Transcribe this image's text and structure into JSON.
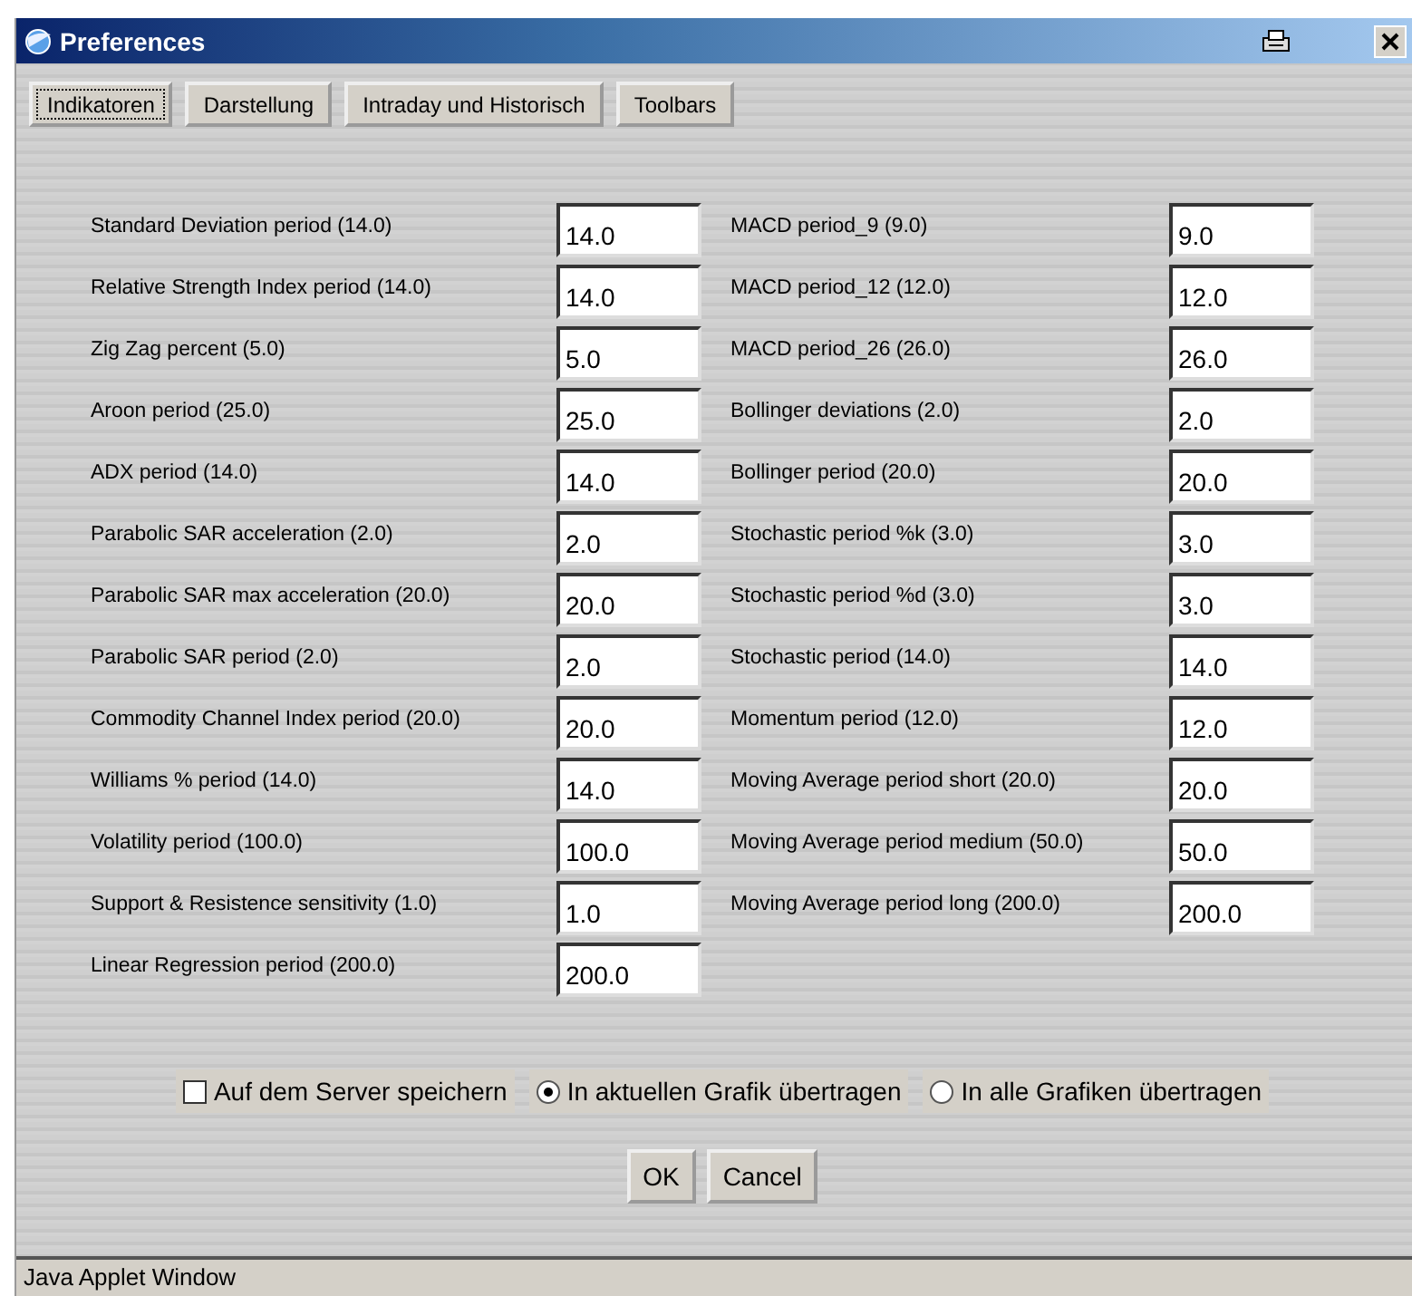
{
  "window": {
    "title": "Preferences"
  },
  "tabs": [
    {
      "label": "Indikatoren",
      "selected": true
    },
    {
      "label": "Darstellung",
      "selected": false
    },
    {
      "label": "Intraday und Historisch",
      "selected": false
    },
    {
      "label": "Toolbars",
      "selected": false
    }
  ],
  "left_fields": [
    {
      "label": "Standard Deviation period (14.0)",
      "value": "14.0"
    },
    {
      "label": "Relative Strength Index period (14.0)",
      "value": "14.0"
    },
    {
      "label": "Zig Zag percent (5.0)",
      "value": "5.0"
    },
    {
      "label": "Aroon period (25.0)",
      "value": "25.0"
    },
    {
      "label": "ADX period (14.0)",
      "value": "14.0"
    },
    {
      "label": "Parabolic SAR acceleration (2.0)",
      "value": "2.0"
    },
    {
      "label": "Parabolic SAR max acceleration (20.0)",
      "value": "20.0"
    },
    {
      "label": "Parabolic SAR period (2.0)",
      "value": "2.0"
    },
    {
      "label": "Commodity Channel Index period (20.0)",
      "value": "20.0"
    },
    {
      "label": "Williams % period (14.0)",
      "value": "14.0"
    },
    {
      "label": "Volatility period (100.0)",
      "value": "100.0"
    },
    {
      "label": "Support & Resistence sensitivity (1.0)",
      "value": "1.0"
    },
    {
      "label": "Linear Regression period (200.0)",
      "value": "200.0"
    }
  ],
  "right_fields": [
    {
      "label": "MACD period_9 (9.0)",
      "value": "9.0"
    },
    {
      "label": "MACD period_12 (12.0)",
      "value": "12.0"
    },
    {
      "label": "MACD period_26 (26.0)",
      "value": "26.0"
    },
    {
      "label": "Bollinger deviations (2.0)",
      "value": "2.0"
    },
    {
      "label": "Bollinger period (20.0)",
      "value": "20.0"
    },
    {
      "label": "Stochastic period %k (3.0)",
      "value": "3.0"
    },
    {
      "label": "Stochastic period %d (3.0)",
      "value": "3.0"
    },
    {
      "label": "Stochastic period (14.0)",
      "value": "14.0"
    },
    {
      "label": "Momentum period (12.0)",
      "value": "12.0"
    },
    {
      "label": "Moving Average period short (20.0)",
      "value": "20.0"
    },
    {
      "label": "Moving Average period medium (50.0)",
      "value": "50.0"
    },
    {
      "label": "Moving Average period long (200.0)",
      "value": "200.0"
    }
  ],
  "options": [
    {
      "kind": "checkbox",
      "label": "Auf dem Server speichern",
      "checked": false
    },
    {
      "kind": "radio",
      "label": "In aktuellen Grafik übertragen",
      "selected": true
    },
    {
      "kind": "radio",
      "label": "In alle Grafiken übertragen",
      "selected": false
    }
  ],
  "buttons": [
    "OK",
    "Cancel"
  ],
  "status_bar": "Java Applet Window"
}
